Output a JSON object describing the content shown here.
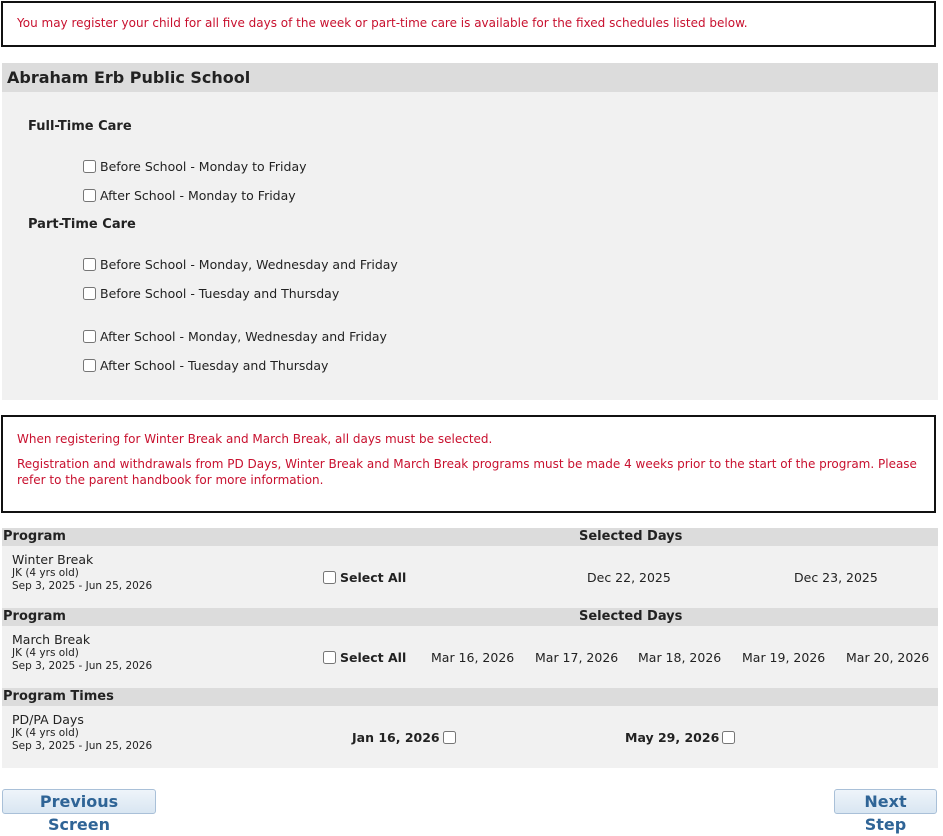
{
  "notices": {
    "top": "You may register your child for all five days of the week or part-time care is available for the fixed schedules listed below.",
    "winter_march": "When registering for Winter Break and March Break, all days must be selected.",
    "deadline": "Registration and withdrawals from PD Days, Winter Break and March Break programs must be made 4 weeks prior to the start of the program. Please refer to the parent handbook for more information."
  },
  "school": {
    "name": "Abraham Erb Public School",
    "full_time": {
      "heading": "Full-Time Care",
      "options": [
        "Before School - Monday to Friday",
        "After School - Monday to Friday"
      ]
    },
    "part_time": {
      "heading": "Part-Time Care",
      "options": [
        "Before School - Monday, Wednesday and Friday",
        "Before School - Tuesday and Thursday",
        "After School - Monday, Wednesday and Friday",
        "After School - Tuesday and Thursday"
      ]
    }
  },
  "programs": {
    "header_program": "Program",
    "header_days": "Selected Days",
    "header_times": "Program Times",
    "select_all_label": "Select All",
    "winter": {
      "name": "Winter Break",
      "grade": "JK (4 yrs old)",
      "dates": "Sep 3, 2025 - Jun 25, 2026",
      "days": [
        "Dec 22, 2025",
        "Dec 23, 2025"
      ]
    },
    "march": {
      "name": "March Break",
      "grade": "JK (4 yrs old)",
      "dates": "Sep 3, 2025 - Jun 25, 2026",
      "days": [
        "Mar 16, 2026",
        "Mar 17, 2026",
        "Mar 18, 2026",
        "Mar 19, 2026",
        "Mar 20, 2026"
      ]
    },
    "pd": {
      "name": "PD/PA Days",
      "grade": "JK (4 yrs old)",
      "dates": "Sep 3, 2025 - Jun 25, 2026",
      "days": [
        "Jan 16, 2026",
        "May 29, 2026"
      ]
    }
  },
  "nav": {
    "previous": "Previous Screen",
    "next": "Next Step"
  }
}
